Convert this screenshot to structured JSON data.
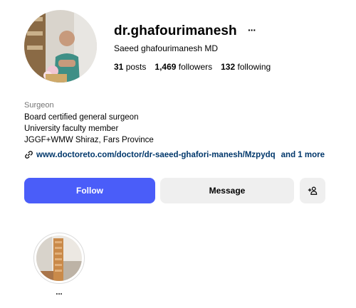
{
  "profile": {
    "username": "dr.ghafourimanesh",
    "more_icon": "···",
    "full_name": "Saeed ghafourimanesh MD",
    "stats": {
      "posts_count": "31",
      "posts_label": "posts",
      "followers_count": "1,469",
      "followers_label": "followers",
      "following_count": "132",
      "following_label": "following"
    },
    "category": "Surgeon",
    "bio": [
      "Board certified general surgeon",
      "University faculty member",
      "JGGF+WMW Shiraz, Fars Province"
    ],
    "link": {
      "url": "www.doctoreto.com/doctor/dr-saeed-ghafori-manesh/Mzpydq",
      "more": "and 1 more"
    }
  },
  "actions": {
    "follow_label": "Follow",
    "message_label": "Message",
    "add_user_icon": "add-person-icon"
  },
  "highlights": [
    {
      "label": "..."
    }
  ],
  "colors": {
    "follow_bg": "#4a5df9",
    "secondary_btn_bg": "#efefef",
    "link": "#00376b",
    "muted": "#737373"
  }
}
